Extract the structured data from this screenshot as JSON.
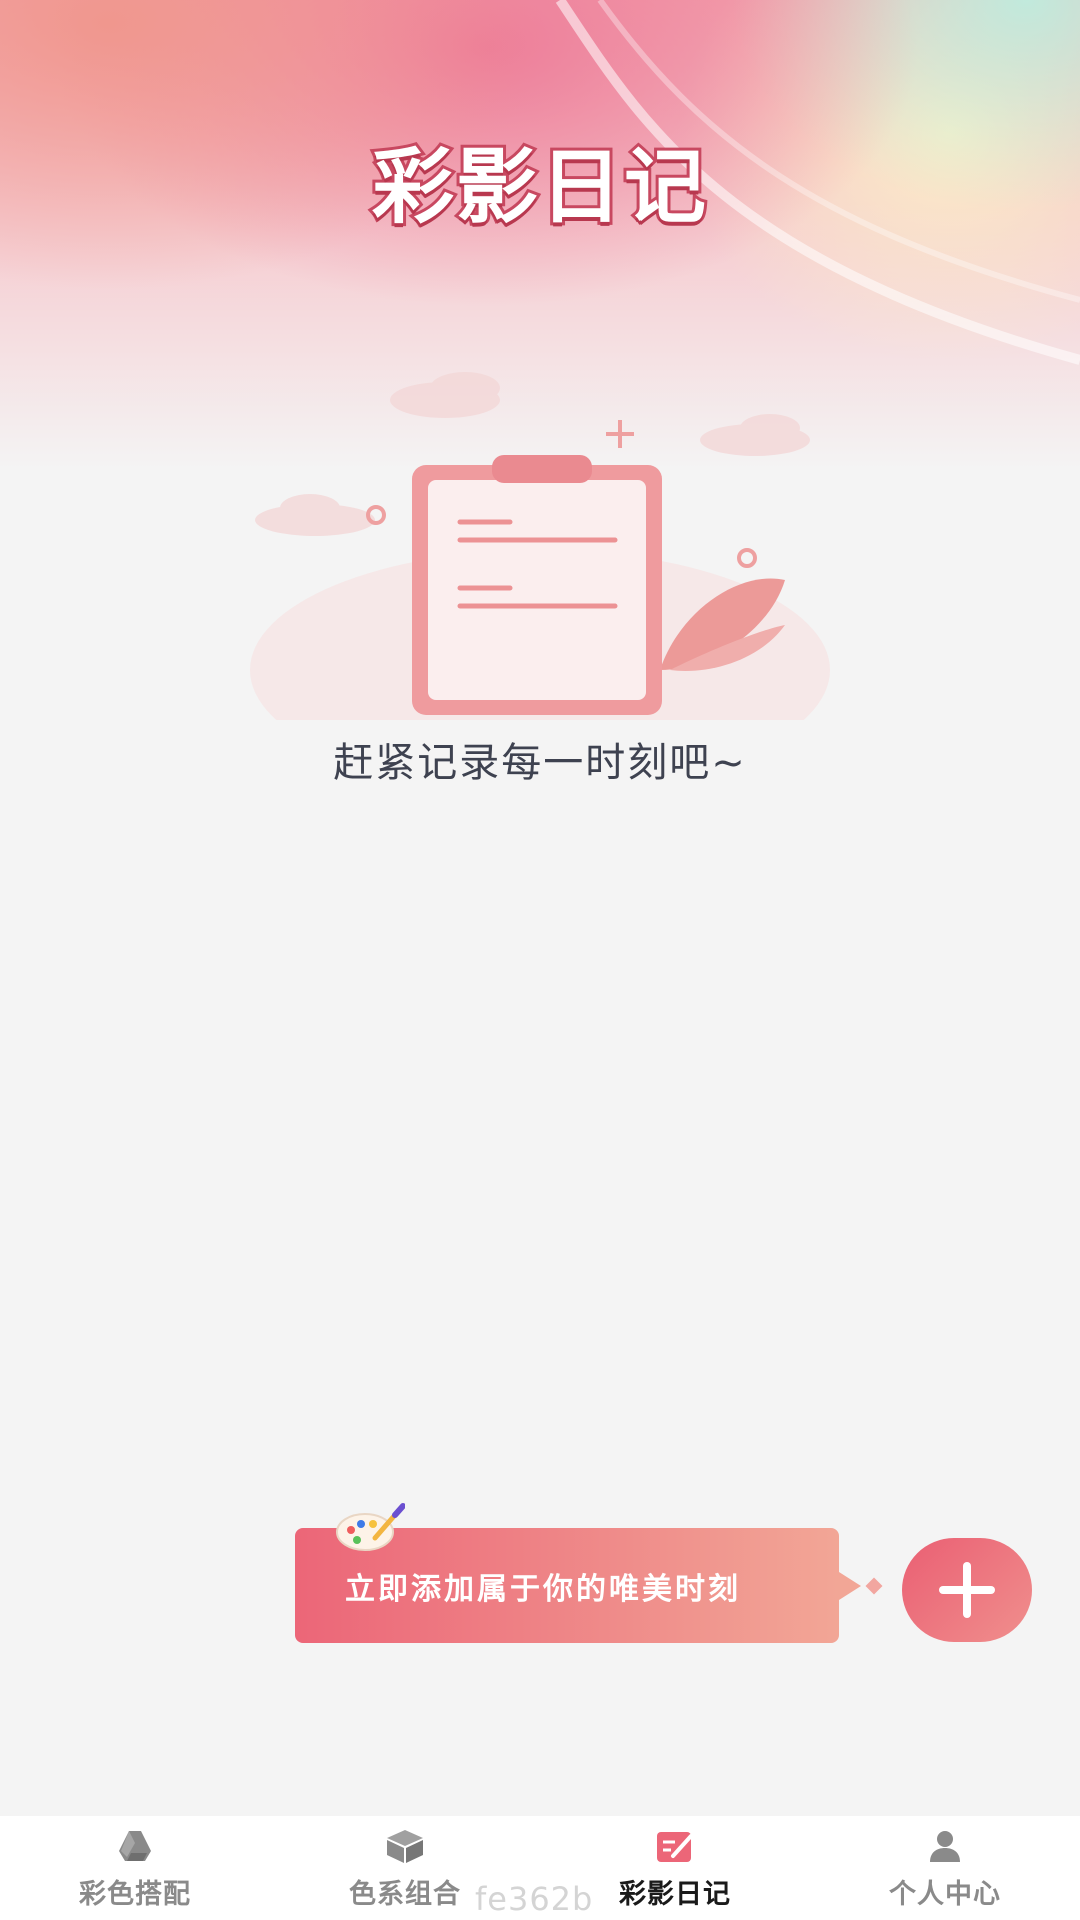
{
  "header": {
    "title": "彩影日记"
  },
  "empty_state": {
    "message": "赶紧记录每一时刻吧~",
    "illustration_icon": "clipboard-icon"
  },
  "add_prompt": {
    "banner_text": "立即添加属于你的唯美时刻",
    "fab_icon": "plus-icon"
  },
  "tabbar": {
    "items": [
      {
        "label": "彩色搭配",
        "icon": "triangle-logo-icon",
        "active": false
      },
      {
        "label": "色系组合",
        "icon": "cube-icon",
        "active": false
      },
      {
        "label": "彩影日记",
        "icon": "note-edit-icon",
        "active": true
      },
      {
        "label": "个人中心",
        "icon": "user-icon",
        "active": false
      }
    ]
  },
  "watermark": "fe362b",
  "colors": {
    "accent": "#ec6678",
    "accent_light": "#f2a696",
    "text_dark": "#3e4250",
    "tab_inactive": "#8a8a8a",
    "background": "#f4f4f4"
  }
}
